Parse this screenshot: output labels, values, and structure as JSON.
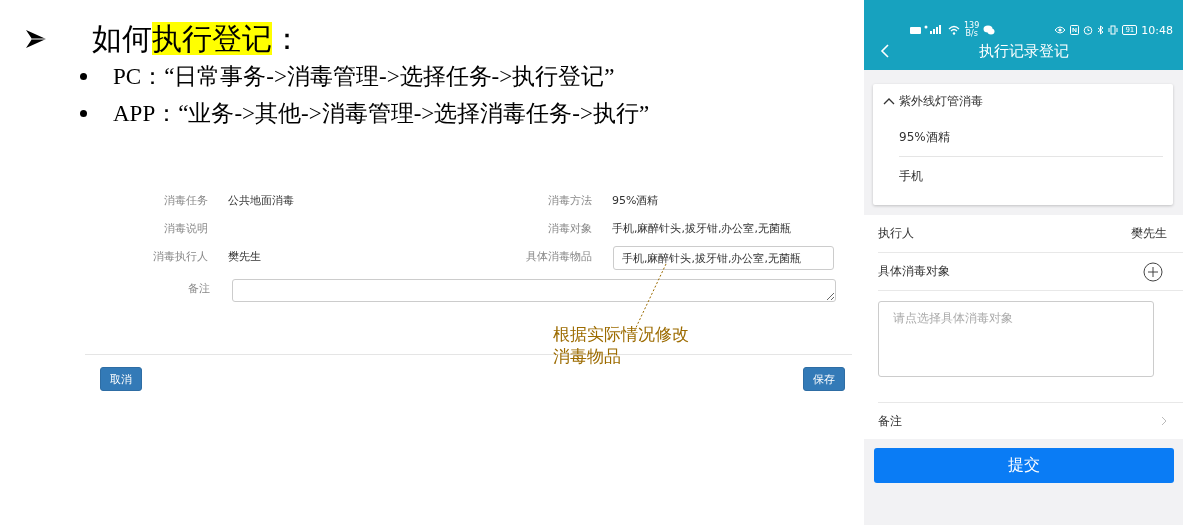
{
  "slide": {
    "heading": {
      "prefix": "如何",
      "highlight": "执行登记",
      "suffix": "："
    },
    "bullets": [
      "PC：“日常事务->消毒管理->选择任务->执行登记”",
      "APP：“业务->其他->消毒管理->选择消毒任务->执行”"
    ]
  },
  "pc_form": {
    "rows": [
      {
        "left": {
          "label": "消毒任务",
          "value": "公共地面消毒"
        },
        "right": {
          "label": "消毒方法",
          "value": "95%酒精",
          "kind": "text"
        }
      },
      {
        "left": {
          "label": "消毒说明"
        },
        "right": {
          "label": "消毒对象",
          "value": "手机,麻醉针头,拔牙钳,办公室,无菌瓶",
          "kind": "text"
        }
      },
      {
        "left": {
          "label": "消毒执行人",
          "value": "樊先生"
        },
        "right": {
          "label": "具体消毒物品",
          "value": "手机,麻醉针头,拔牙钳,办公室,无菌瓶",
          "kind": "input"
        }
      }
    ],
    "remark": {
      "label": "备注"
    },
    "annotation": "根据实际情况修改消毒物品",
    "buttons": [
      {
        "label": "取消"
      },
      {
        "label": "保存"
      }
    ]
  },
  "phone": {
    "status_bar": {
      "speed": "139",
      "speed_unit": "B/s",
      "battery": "91",
      "time": "10:48"
    },
    "title": "执行记录登记",
    "group": {
      "title": "紫外线灯管消毒",
      "expanded": true,
      "items": [
        "95%酒精",
        "手机"
      ]
    },
    "executor": {
      "label": "执行人",
      "value": "樊先生"
    },
    "target": {
      "label": "具体消毒对象",
      "placeholder": "请点选择具体消毒对象"
    },
    "remark": {
      "label": "备注"
    },
    "submit": "提交"
  }
}
